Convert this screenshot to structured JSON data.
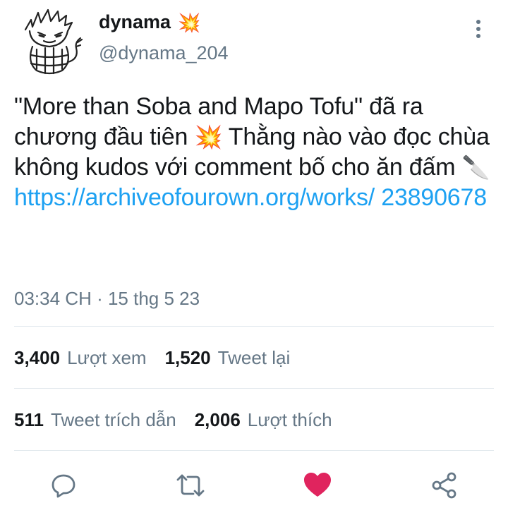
{
  "author": {
    "display_name": "dynama",
    "name_emoji": "💥",
    "handle": "@dynama_204"
  },
  "tweet": {
    "text_line1": "\"More than Soba and Mapo Tofu\" đã ra chương đầu tiên ",
    "emoji_collision": "💥",
    "text_line2": " Thằng nào vào đọc chùa không kudos với comment bố cho ăn đấm ",
    "emoji_knife": "🔪",
    "link_text": "https://archiveofourown.org/works/ 23890678",
    "timestamp": "03:34 CH · 15 thg 5 23"
  },
  "stats": {
    "views": {
      "count": "3,400",
      "label": "Lượt xem"
    },
    "retweets": {
      "count": "1,520",
      "label": "Tweet lại"
    },
    "quotes": {
      "count": "511",
      "label": "Tweet trích dẫn"
    },
    "likes": {
      "count": "2,006",
      "label": "Lượt thích"
    }
  },
  "actions": {
    "reply_icon": "reply-icon",
    "retweet_icon": "retweet-icon",
    "like_icon": "heart-icon",
    "share_icon": "share-icon",
    "liked": true
  },
  "colors": {
    "link": "#1da1f2",
    "secondary_text": "#657786",
    "like_active": "#e0245e",
    "icon": "#657786"
  }
}
